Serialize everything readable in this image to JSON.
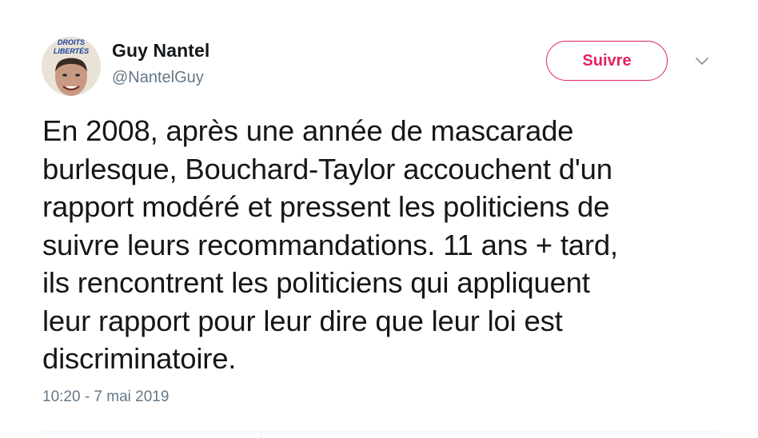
{
  "author": {
    "name": "Guy Nantel",
    "handle": "@NantelGuy",
    "avatar_text_top": "DROITS",
    "avatar_text_bottom": "LIBERTÉS"
  },
  "follow_button": {
    "label": "Suivre",
    "color": "#e0245e"
  },
  "menu_icon": "chevron-down-icon",
  "tweet": {
    "lines": [
      "En 2008, après une année de mascarade",
      "burlesque, Bouchard-Taylor accouchent d'un",
      "rapport modéré et pressent les politiciens de",
      "suivre leurs recommandations. 11 ans + tard,",
      "ils rencontrent les politiciens qui appliquent",
      "leur rapport pour leur dire que leur loi est",
      "discriminatoire."
    ],
    "timestamp": "10:20 - 7 mai 2019"
  }
}
